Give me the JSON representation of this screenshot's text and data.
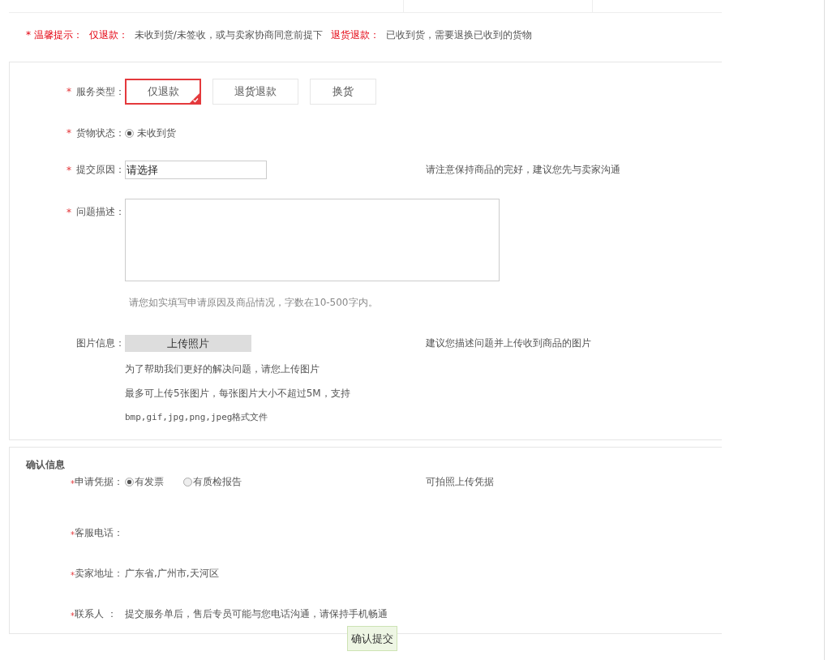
{
  "tip": {
    "title": "* 温馨提示：",
    "items": [
      {
        "label": "仅退款：",
        "text": "未收到货/未签收，或与卖家协商同意前提下"
      },
      {
        "label": "退货退款：",
        "text": "已收到货，需要退换已收到的货物"
      }
    ]
  },
  "form": {
    "service_type": {
      "mark": "*",
      "label": "服务类型：",
      "options": [
        {
          "label": "仅退款",
          "selected": true
        },
        {
          "label": "退货退款",
          "selected": false
        },
        {
          "label": "换货",
          "selected": false
        }
      ]
    },
    "goods_status": {
      "mark": "*",
      "label": "货物状态：",
      "options": [
        {
          "label": "未收到货",
          "selected": true
        }
      ]
    },
    "reason": {
      "mark": "*",
      "label": "提交原因：",
      "value": "请选择",
      "hint": "请注意保持商品的完好，建议您先与卖家沟通"
    },
    "description": {
      "mark": "*",
      "label": "问题描述：",
      "hint": "请您如实填写申请原因及商品情况，字数在10-500字内。"
    },
    "images": {
      "label": "图片信息：",
      "button": "上传照片",
      "hint": "建议您描述问题并上传收到商品的图片",
      "notes": [
        "为了帮助我们更好的解决问题，请您上传图片",
        "最多可上传5张图片，每张图片大小不超过5M，支持",
        "bmp,gif,jpg,png,jpeg格式文件"
      ]
    }
  },
  "confirm": {
    "title": "确认信息",
    "rows": [
      {
        "kind": "radio",
        "mark": "*",
        "label": "申请凭据：",
        "options": [
          {
            "label": "有发票",
            "selected": true
          },
          {
            "label": "有质检报告",
            "selected": false
          }
        ],
        "hint": "可拍照上传凭据"
      },
      {
        "kind": "text",
        "mark": "*",
        "label": "客服电话："
      },
      {
        "kind": "text",
        "mark": "*",
        "label": "卖家地址：",
        "value": "广东省,广州市,天河区"
      },
      {
        "kind": "text",
        "mark": "*",
        "label": "联系人 ：",
        "value": "提交服务单后，售后专员可能与您电话沟通，请保持手机畅通"
      }
    ]
  },
  "submit": "确认提交"
}
